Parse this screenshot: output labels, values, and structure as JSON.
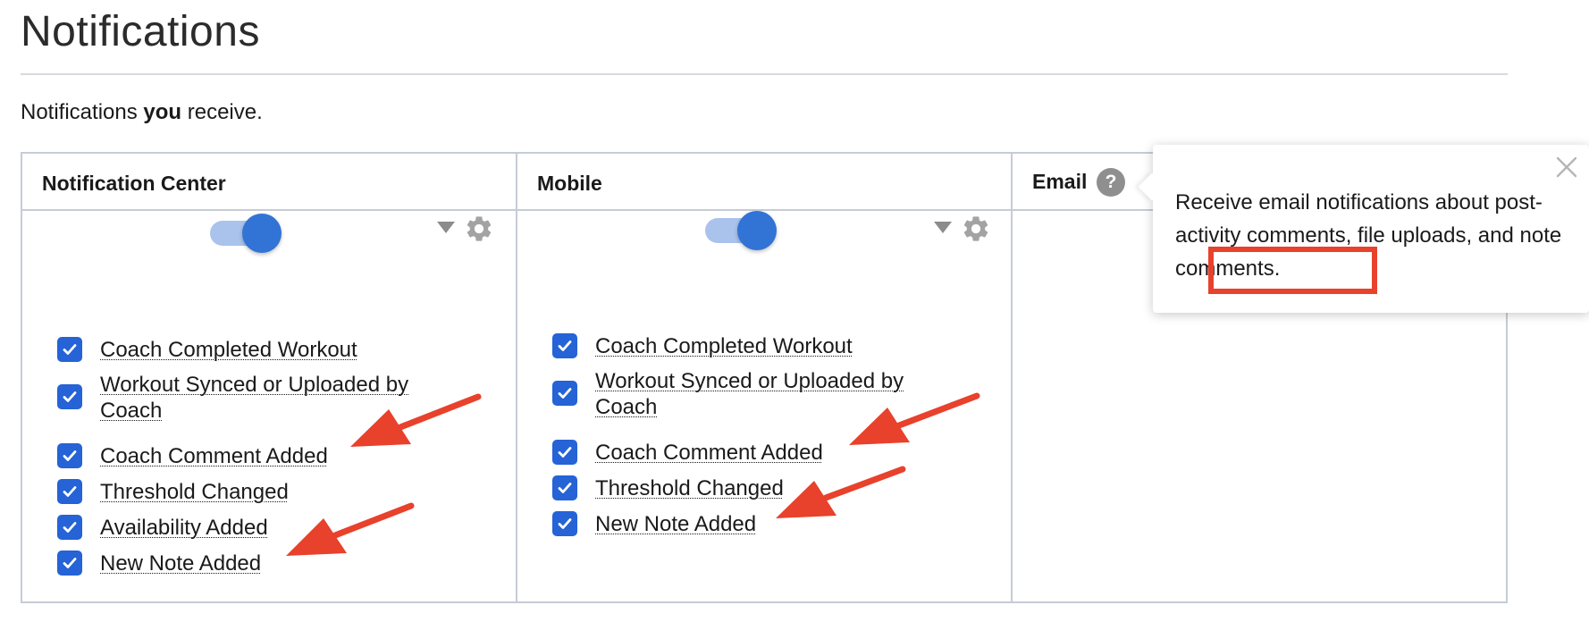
{
  "page": {
    "title": "Notifications",
    "intro_prefix": "Notifications ",
    "intro_bold": "you",
    "intro_suffix": " receive."
  },
  "columns": [
    {
      "title": "Notification Center",
      "toggle_on": true,
      "options": [
        {
          "label": "Coach Completed Workout",
          "checked": true
        },
        {
          "label": "Workout Synced or Uploaded by Coach",
          "checked": true
        },
        {
          "label": "Coach Comment Added",
          "checked": true
        },
        {
          "label": "Threshold Changed",
          "checked": true
        },
        {
          "label": "Availability Added",
          "checked": true
        },
        {
          "label": "New Note Added",
          "checked": true
        }
      ]
    },
    {
      "title": "Mobile",
      "toggle_on": true,
      "options": [
        {
          "label": "Coach Completed Workout",
          "checked": true
        },
        {
          "label": "Workout Synced or Uploaded by Coach",
          "checked": true
        },
        {
          "label": "Coach Comment Added",
          "checked": true
        },
        {
          "label": "Threshold Changed",
          "checked": true
        },
        {
          "label": "New Note Added",
          "checked": true
        }
      ]
    },
    {
      "title": "Email",
      "help_icon": "?"
    }
  ],
  "popover": {
    "text_before": "Receive email notifications about post-activity comments, file uploads, and ",
    "text_highlight": "note comments",
    "text_after": "."
  },
  "icons": {
    "toggle": "toggle-switch",
    "caret": "caret-down-icon",
    "gear": "gear-icon",
    "checkbox": "checkmark-icon",
    "close": "close-icon",
    "help": "help-icon"
  },
  "colors": {
    "accent": "#2563d6",
    "toggle_knob": "#3273d6",
    "toggle_track": "#a9c3ec",
    "annotation": "#e8412c",
    "border": "#c5ccd6"
  }
}
